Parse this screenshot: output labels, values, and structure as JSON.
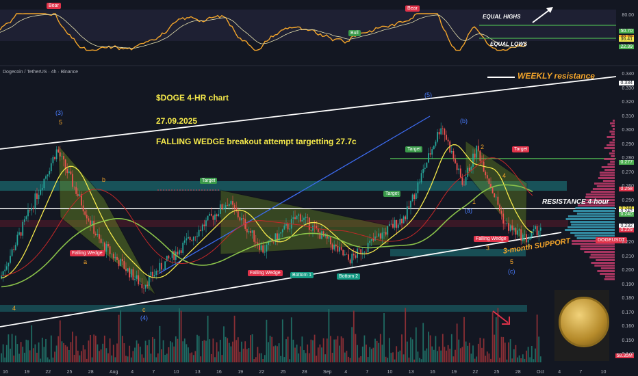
{
  "chart_title": "Dogecoin / TetherUS · 4h · Binance",
  "annotations": {
    "headline": "$DOGE   4-HR chart",
    "date": "27.09.2025",
    "thesis": "FALLING WEDGE breakout attempt targetting 27.7c",
    "weekly": "WEEKLY resistance",
    "resistance4h": "RESISTANCE 4-hour",
    "support3m": "3-month SUPPORT",
    "equal_highs": "EQUAL HIGHS",
    "equal_lows": "EQUAL LOWS"
  },
  "tags": {
    "bear1": "Bear",
    "bear2": "Bear",
    "bull": "Bull",
    "target1": "Target",
    "target2": "Target",
    "target3": "Target",
    "target4": "Target",
    "fw1": "Falling Wedge",
    "fw2": "Falling Wedge",
    "fw3": "Falling Wedge",
    "bottom1": "Bottom 1",
    "bottom2": "Bottom 2",
    "symbol": "DOGEUSDT"
  },
  "waves": {
    "w3": "(3)",
    "w5a": "5",
    "wb": "b",
    "wa": "a",
    "wc": "c",
    "w4": "(4)",
    "w4b": "4",
    "w5": "(5)",
    "wB": "(b)",
    "w2": "2",
    "w4c": "4",
    "w1": "1",
    "wA": "(a)",
    "w3c": "3",
    "w5c": "5",
    "wC": "(c)"
  },
  "price_axis": {
    "ticks": [
      "0.340",
      "0.330",
      "0.320",
      "0.310",
      "0.300",
      "0.290",
      "0.280",
      "0.270",
      "0.260",
      "0.250",
      "0.240",
      "0.230",
      "0.220",
      "0.210",
      "0.200",
      "0.190",
      "0.180",
      "0.170",
      "0.160",
      "0.150",
      "0.140"
    ],
    "boxes": [
      {
        "label": "0.334",
        "bg": "#ffffff",
        "fg": "#131722"
      },
      {
        "label": "0.277",
        "bg": "#4caf50",
        "fg": "#ffffff"
      },
      {
        "label": "0.258",
        "bg": "#e0334a",
        "fg": "#ffffff"
      },
      {
        "label": "0.244",
        "bg": "#f5e94b",
        "fg": "#131722"
      },
      {
        "label": "0.242",
        "bg": "#ffffff",
        "fg": "#131722"
      },
      {
        "label": "0.240",
        "bg": "#4caf50",
        "fg": "#ffffff"
      },
      {
        "label": "0.232",
        "bg": "#2a2e39",
        "fg": "#ffffff"
      },
      {
        "label": "0.232",
        "bg": "#ffffff",
        "fg": "#131722"
      },
      {
        "label": "0.229",
        "bg": "#e0334a",
        "fg": "#ffffff"
      },
      {
        "label": "58.35M",
        "bg": "#e0334a",
        "fg": "#ffffff"
      }
    ]
  },
  "rsi_axis": {
    "ticks": [
      "80.00",
      "20.00"
    ],
    "boxes": [
      {
        "label": "50.70",
        "bg": "#4caf50",
        "fg": "#ffffff"
      },
      {
        "label": "40.29",
        "bg": "#f4a52a",
        "fg": "#131722"
      },
      {
        "label": "36.41",
        "bg": "#f5e94b",
        "fg": "#131722"
      },
      {
        "label": "22.39",
        "bg": "#4caf50",
        "fg": "#ffffff"
      }
    ]
  },
  "time_axis": [
    "16",
    "19",
    "22",
    "25",
    "28",
    "Aug",
    "4",
    "7",
    "10",
    "13",
    "16",
    "19",
    "22",
    "25",
    "28",
    "Sep",
    "4",
    "7",
    "10",
    "13",
    "16",
    "19",
    "22",
    "25",
    "28",
    "Oct",
    "4",
    "7",
    "10"
  ],
  "colors": {
    "bg": "#131722",
    "up": "#26a69a",
    "down": "#ef5350",
    "ma_yellow": "#f5e94b",
    "ma_green": "#8bc34a",
    "ma_red": "#c62828",
    "rsi": "#f4a52a",
    "wedge_fill": "#6b8e23",
    "zone_teal": "#1a5d63",
    "zone_red": "#5a1a2a"
  },
  "chart_data": {
    "type": "candlestick",
    "title": "Dogecoin / TetherUS · 4h · Binance",
    "ylim": [
      0.14,
      0.345
    ],
    "levels": {
      "weekly_resistance": 0.334,
      "target": 0.277,
      "resistance_4h": 0.242,
      "support": 0.229
    },
    "swing_points": [
      {
        "date": "Jul 13",
        "price": 0.195
      },
      {
        "date": "Jul 21",
        "price": 0.287
      },
      {
        "date": "Jul 27",
        "price": 0.221
      },
      {
        "date": "Aug 2",
        "price": 0.19
      },
      {
        "date": "Aug 14",
        "price": 0.25
      },
      {
        "date": "Aug 19",
        "price": 0.215
      },
      {
        "date": "Aug 24",
        "price": 0.24
      },
      {
        "date": "Aug 31",
        "price": 0.208
      },
      {
        "date": "Sep 8",
        "price": 0.24
      },
      {
        "date": "Sep 13",
        "price": 0.305
      },
      {
        "date": "Sep 16",
        "price": 0.262
      },
      {
        "date": "Sep 18",
        "price": 0.288
      },
      {
        "date": "Sep 22",
        "price": 0.233
      },
      {
        "date": "Sep 25",
        "price": 0.223
      },
      {
        "date": "Sep 27",
        "price": 0.232
      }
    ]
  }
}
